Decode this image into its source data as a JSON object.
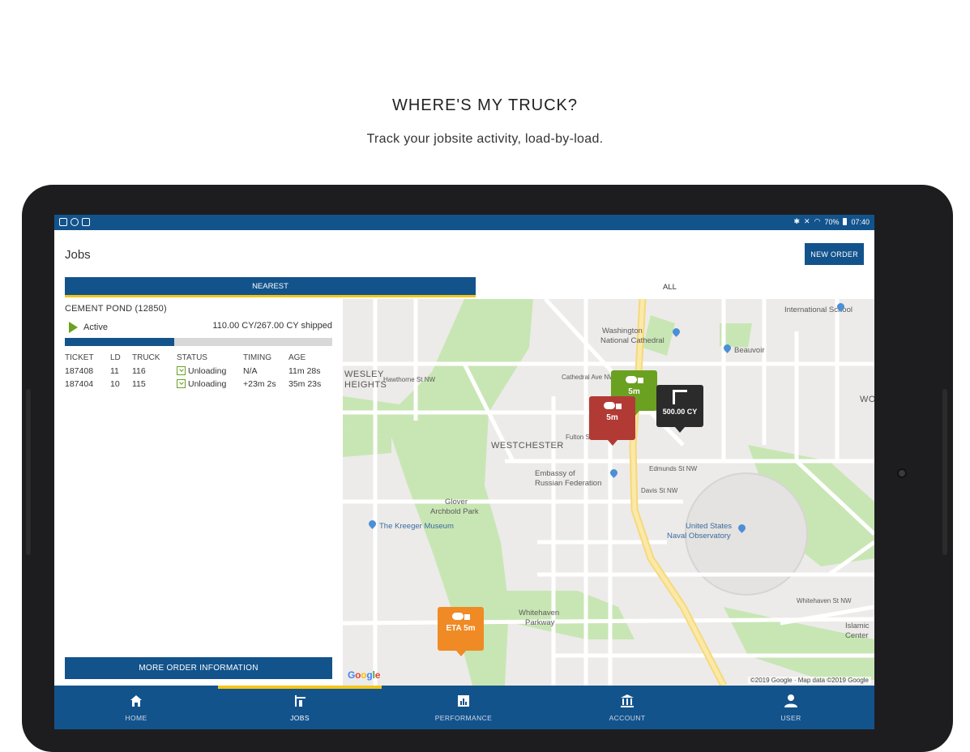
{
  "promo": {
    "title": "WHERE'S MY TRUCK?",
    "subtitle": "Track your jobsite activity, load-by-load."
  },
  "statusbar": {
    "battery": "70%",
    "time": "07:40"
  },
  "appbar": {
    "title": "Jobs",
    "new_order_label": "NEW ORDER"
  },
  "tabs": [
    {
      "label": "NEAREST",
      "selected": true
    },
    {
      "label": "ALL",
      "selected": false
    }
  ],
  "job": {
    "name": "CEMENT POND (12850)",
    "status": "Active",
    "shipped": "110.00 CY/267.00 CY shipped",
    "progress_fraction": 0.41,
    "columns": [
      "TICKET",
      "LD",
      "TRUCK",
      "STATUS",
      "TIMING",
      "AGE"
    ],
    "rows": [
      {
        "ticket": "187408",
        "ld": "11",
        "truck": "116",
        "status": "Unloading",
        "timing": "N/A",
        "age": "11m 28s"
      },
      {
        "ticket": "187404",
        "ld": "10",
        "truck": "115",
        "status": "Unloading",
        "timing": "+23m 2s",
        "age": "35m 23s"
      }
    ],
    "more_button_label": "MORE ORDER INFORMATION"
  },
  "map": {
    "markers": [
      {
        "label": "5m",
        "color": "#6aa121"
      },
      {
        "label": "5m",
        "color": "#b23a34"
      },
      {
        "label": "500.00 CY",
        "color": "#2b2b2b"
      },
      {
        "label": "ETA 5m",
        "color": "#f08a24"
      }
    ],
    "labels": {
      "wesley": "WESLEY",
      "heights": "HEIGHTS",
      "westchester": "WESTCHESTER",
      "washington_1": "Washington",
      "washington_2": "National Cathedral",
      "intl_school": "International School",
      "beauvoir": "Beauvoir",
      "embassy_1": "Embassy of",
      "embassy_2": "Russian Federation",
      "clover_1": "Glover",
      "clover_2": "Archbold Park",
      "kreeger": "The Kreeger Museum",
      "observatory_1": "United States",
      "observatory_2": "Naval Observatory",
      "whitehaven_1": "Whitehaven",
      "whitehaven_2": "Parkway",
      "wo": "WO",
      "islamic_1": "Islamic",
      "islamic_2": "Center",
      "cathedral_st": "Cathedral Ave NW",
      "fulton": "Fulton St NW",
      "edmunds": "Edmunds St NW",
      "davis": "Davis St NW",
      "hawthorne": "Hawthorne St NW",
      "whitehaven_st": "Whitehaven St NW"
    },
    "google": "Google",
    "attribution": "©2019 Google · Map data ©2019 Google"
  },
  "bottomnav": [
    {
      "label": "HOME",
      "icon": "home-icon",
      "selected": false
    },
    {
      "label": "JOBS",
      "icon": "jobs-icon",
      "selected": true
    },
    {
      "label": "PERFORMANCE",
      "icon": "performance-icon",
      "selected": false
    },
    {
      "label": "ACCOUNT",
      "icon": "account-icon",
      "selected": false
    },
    {
      "label": "USER",
      "icon": "user-icon",
      "selected": false
    }
  ]
}
